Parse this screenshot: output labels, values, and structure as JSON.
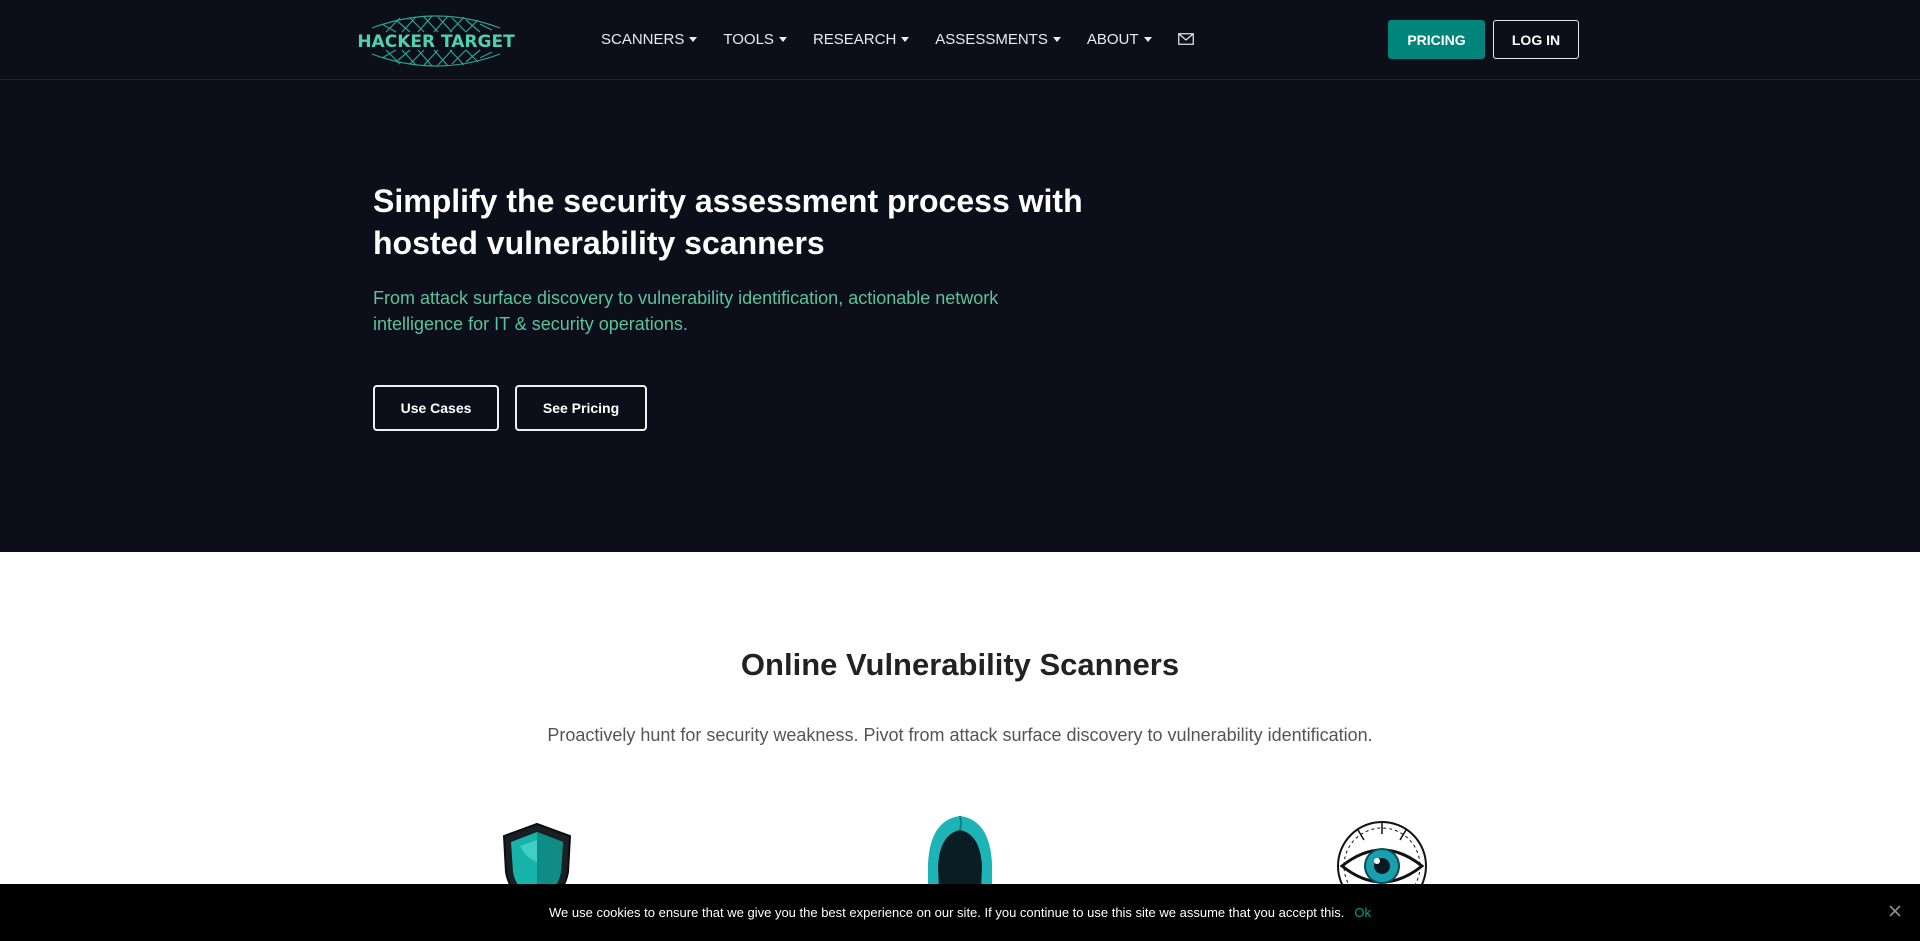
{
  "header": {
    "logo_text": "HACKER TARGET",
    "nav": [
      {
        "label": "SCANNERS"
      },
      {
        "label": "TOOLS"
      },
      {
        "label": "RESEARCH"
      },
      {
        "label": "ASSESSMENTS"
      },
      {
        "label": "ABOUT"
      }
    ],
    "contact_icon": "mail-icon",
    "pricing_label": "PRICING",
    "login_label": "LOG IN"
  },
  "hero": {
    "title": "Simplify the security assessment process with hosted vulnerability scanners",
    "subtitle": "From attack surface discovery to vulnerability identification, actionable network intelligence for IT & security operations.",
    "use_cases_label": "Use Cases",
    "see_pricing_label": "See Pricing"
  },
  "scanners_section": {
    "title": "Online Vulnerability Scanners",
    "subtitle": "Proactively hunt for security weakness. Pivot from attack surface discovery to vulnerability identification.",
    "icons": [
      "shield-icon",
      "hooded-hacker-icon",
      "eye-icon"
    ]
  },
  "cookie_bar": {
    "text": "We use cookies to ensure that we give you the best experience on our site. If you continue to use this site we assume that you accept this.",
    "ok_label": "Ok",
    "close_icon": "close-icon"
  },
  "colors": {
    "nav_background": "#0c0f1a",
    "accent_teal": "#00857a",
    "hero_subtitle": "#5ac2a0",
    "cookie_background": "#000000"
  }
}
